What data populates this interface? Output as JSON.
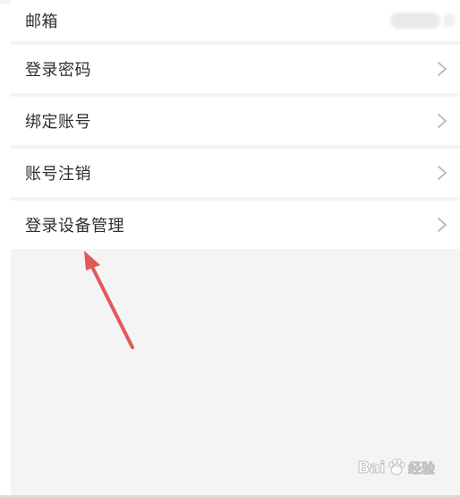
{
  "settings": {
    "items": [
      {
        "label": "邮箱",
        "has_chevron": false,
        "value_hidden": true
      },
      {
        "label": "登录密码",
        "has_chevron": true
      },
      {
        "label": "绑定账号",
        "has_chevron": true
      },
      {
        "label": "账号注销",
        "has_chevron": true
      },
      {
        "label": "登录设备管理",
        "has_chevron": true
      }
    ]
  },
  "annotation": {
    "arrow_color": "#e05a5a",
    "points_to": "登录设备管理"
  },
  "watermark": {
    "brand_prefix": "Bai",
    "brand_suffix": "经验",
    "icon": "baidu-paw-icon"
  },
  "colors": {
    "background": "#f4f4f4",
    "row_background": "#ffffff",
    "text": "#2f2f2f",
    "chevron": "#b5b5b5"
  }
}
